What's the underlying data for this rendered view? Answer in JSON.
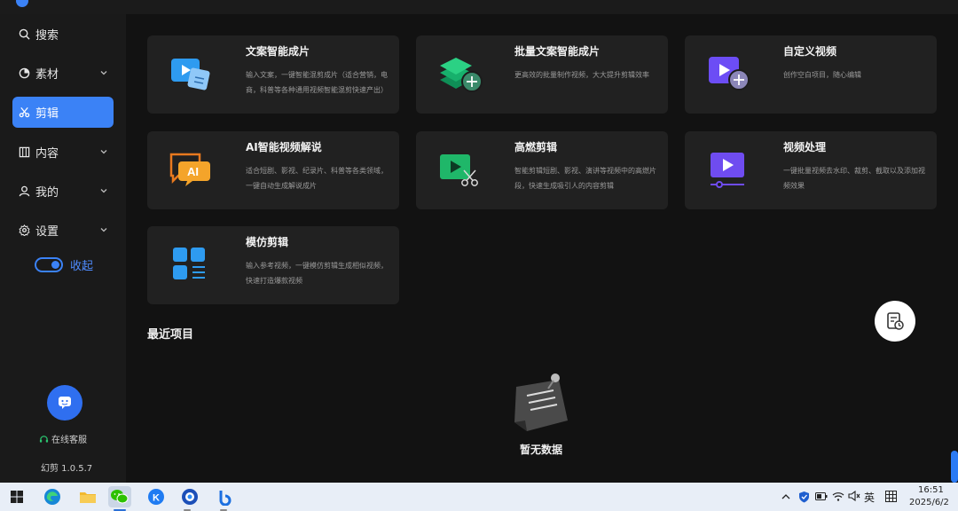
{
  "app": {
    "title": ""
  },
  "sidebar": {
    "items": [
      {
        "label": "搜索",
        "icon": "search-icon",
        "expandable": false,
        "active": false
      },
      {
        "label": "素材",
        "icon": "material-icon",
        "expandable": true,
        "active": false
      },
      {
        "label": "剪辑",
        "icon": "scissors-icon",
        "expandable": false,
        "active": true
      },
      {
        "label": "内容",
        "icon": "content-icon",
        "expandable": true,
        "active": false
      },
      {
        "label": "我的",
        "icon": "user-icon",
        "expandable": true,
        "active": false
      },
      {
        "label": "设置",
        "icon": "gear-icon",
        "expandable": true,
        "active": false
      }
    ],
    "collapse_label": "收起",
    "service_label": "在线客服",
    "version": "幻剪 1.0.5.7"
  },
  "cards": [
    {
      "title": "文案智能成片",
      "desc": "输入文案，一键智能混剪成片（适合营销，电商，科普等各种通用视频智能混剪快速产出）",
      "icon": "video-doc-icon"
    },
    {
      "title": "批量文案智能成片",
      "desc": "更高效的批量制作视频，大大提升剪辑效率",
      "icon": "layers-plus-icon"
    },
    {
      "title": "自定义视频",
      "desc": "创作空白项目，随心编辑",
      "icon": "video-plus-icon"
    },
    {
      "title": "AI智能视频解说",
      "desc": "适合短剧、影视、纪录片、科普等各类领域，一键自动生成解说成片",
      "icon": "ai-chat-icon"
    },
    {
      "title": "高燃剪辑",
      "desc": "智能剪辑短剧、影视、演讲等视频中的高燃片段，快速生成吸引人的内容剪辑",
      "icon": "video-cut-icon"
    },
    {
      "title": "视频处理",
      "desc": "一键批量视频去水印、裁剪、截取以及添加视频效果",
      "icon": "video-process-icon"
    },
    {
      "title": "模仿剪辑",
      "desc": "输入参考视频，一键模仿剪辑生成相似视频，快速打造爆款视频",
      "icon": "grid-icon"
    }
  ],
  "recent": {
    "title": "最近项目",
    "empty_text": "暂无数据"
  },
  "taskbar": {
    "apps": [
      "windows-start-icon",
      "edge-icon",
      "folder-icon",
      "wechat-icon",
      "k-app-icon",
      "browser-icon",
      "bilibili-icon"
    ],
    "ime": "英",
    "time": "16:51",
    "date": "2025/6/2"
  },
  "colors": {
    "accent": "#3b82f6",
    "background": "#121212",
    "card": "#212121",
    "sidebar": "#1a1a1a"
  }
}
